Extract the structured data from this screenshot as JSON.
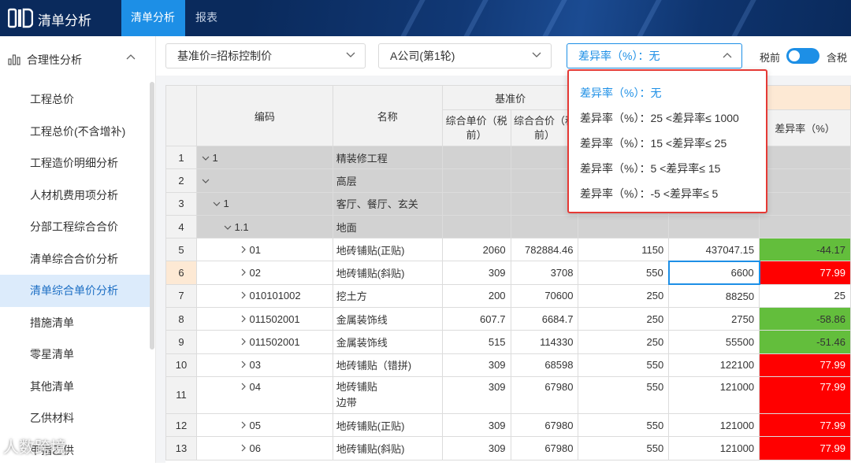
{
  "header": {
    "app_title": "清单分析",
    "tabs": [
      {
        "label": "清单分析",
        "active": true
      },
      {
        "label": "报表",
        "active": false
      }
    ],
    "colors": {
      "bar": "#0a2a5c",
      "accent": "#1d8fe6"
    }
  },
  "sidebar": {
    "group_label": "合理性分析",
    "group_icon": "bar-chart-icon",
    "items": [
      {
        "label": "工程总价"
      },
      {
        "label": "工程总价(不含增补)"
      },
      {
        "label": "工程造价明细分析"
      },
      {
        "label": "人材机费用项分析"
      },
      {
        "label": "分部工程综合合价"
      },
      {
        "label": "清单综合合价分析"
      },
      {
        "label": "清单综合单价分析",
        "active": true
      },
      {
        "label": "措施清单"
      },
      {
        "label": "零星清单"
      },
      {
        "label": "其他清单"
      },
      {
        "label": "乙供材料"
      },
      {
        "label": "甲指乙供"
      }
    ]
  },
  "toolbar": {
    "baseline_select": "基准价=招标控制价",
    "company_select": "A公司(第1轮)",
    "diff_select": "差异率（%）：无",
    "tax_excl": "税前",
    "tax_incl": "含税",
    "tax_toggle_on": true
  },
  "dropdown": {
    "options": [
      {
        "label": "差异率（%）：无",
        "active": true
      },
      {
        "label": "差异率（%）：25 <差异率≤ 1000"
      },
      {
        "label": "差异率（%）：15 <差异率≤ 25"
      },
      {
        "label": "差异率（%）：5 <差异率≤ 15"
      },
      {
        "label": "差异率（%）：-5 <差异率≤ 5"
      }
    ]
  },
  "table": {
    "headers": {
      "code": "编码",
      "name": "名称",
      "base_group": "基准价",
      "base_unit": "综合单价（税前）",
      "base_total": "综合合价（税前）",
      "diff": "差异率（%）"
    },
    "rows": [
      {
        "idx": "1",
        "code": "1",
        "level": 0,
        "expand": "down",
        "name": "精装修工程",
        "group": true
      },
      {
        "idx": "2",
        "code": "",
        "level": 0,
        "expand": "down",
        "name": "高层",
        "group": true
      },
      {
        "idx": "3",
        "code": "1",
        "level": 1,
        "expand": "down",
        "name": "客厅、餐厅、玄关",
        "group": true
      },
      {
        "idx": "4",
        "code": "1.1",
        "level": 2,
        "expand": "down",
        "name": "地面",
        "group": true
      },
      {
        "idx": "5",
        "code": "01",
        "level": 3,
        "expand": "right",
        "name": "地砖铺贴(正贴)",
        "c1": "2060",
        "c2": "782884.46",
        "c3": "1150",
        "c4": "437047.15",
        "diff": "-44.17",
        "tone": "green"
      },
      {
        "idx": "6",
        "code": "02",
        "level": 3,
        "expand": "right",
        "name": "地砖铺贴(斜贴)",
        "c1": "309",
        "c2": "3708",
        "c3": "550",
        "c4": "6600",
        "diff": "77.99",
        "tone": "red",
        "selected": true
      },
      {
        "idx": "7",
        "code": "010101002",
        "level": 3,
        "expand": "right",
        "name": "挖土方",
        "c1": "200",
        "c2": "70600",
        "c3": "250",
        "c4": "88250",
        "diff": "25",
        "tone": "none"
      },
      {
        "idx": "8",
        "code": "011502001",
        "level": 3,
        "expand": "right",
        "name": "金属装饰线",
        "c1": "607.7",
        "c2": "6684.7",
        "c3": "250",
        "c4": "2750",
        "diff": "-58.86",
        "tone": "green"
      },
      {
        "idx": "9",
        "code": "011502001",
        "level": 3,
        "expand": "right",
        "name": "金属装饰线",
        "c1": "515",
        "c2": "114330",
        "c3": "250",
        "c4": "55500",
        "diff": "-51.46",
        "tone": "green"
      },
      {
        "idx": "10",
        "code": "03",
        "level": 3,
        "expand": "right",
        "name": "地砖铺贴（错拼)",
        "c1": "309",
        "c2": "68598",
        "c3": "550",
        "c4": "122100",
        "diff": "77.99",
        "tone": "red"
      },
      {
        "idx": "11",
        "code": "04",
        "level": 3,
        "expand": "right",
        "name": "地砖铺贴",
        "name2": "边带",
        "c1": "309",
        "c2": "67980",
        "c3": "550",
        "c4": "121000",
        "diff": "77.99",
        "tone": "red",
        "tall": true
      },
      {
        "idx": "12",
        "code": "05",
        "level": 3,
        "expand": "right",
        "name": "地砖铺贴(正贴)",
        "c1": "309",
        "c2": "67980",
        "c3": "550",
        "c4": "121000",
        "diff": "77.99",
        "tone": "red"
      },
      {
        "idx": "13",
        "code": "06",
        "level": 3,
        "expand": "right",
        "name": "地砖铺贴(斜贴)",
        "c1": "309",
        "c2": "67980",
        "c3": "550",
        "c4": "121000",
        "diff": "77.99",
        "tone": "red"
      }
    ]
  },
  "watermark": "人数跨境"
}
